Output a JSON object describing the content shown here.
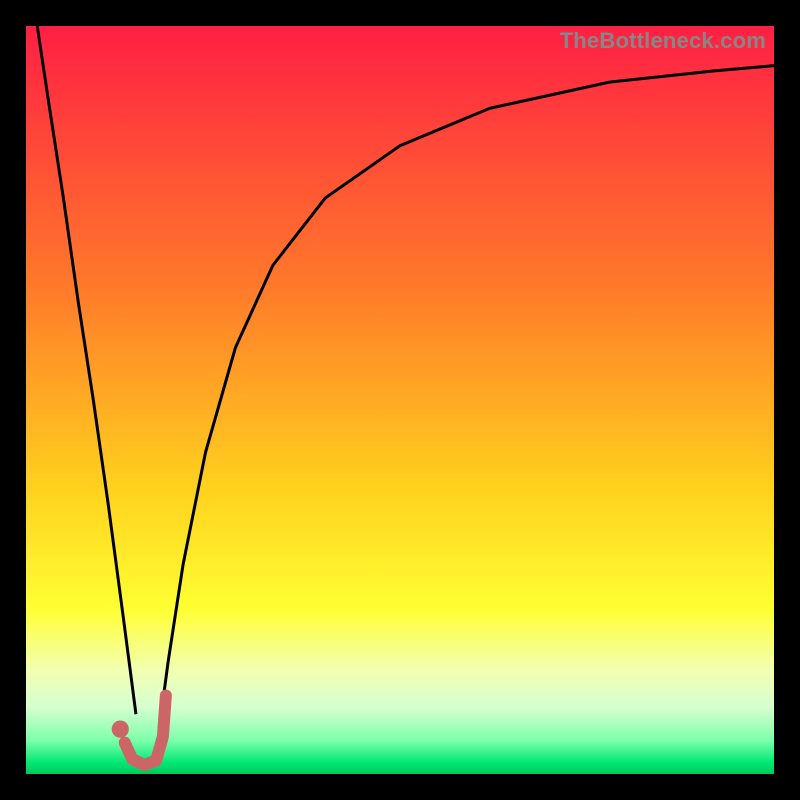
{
  "watermark": "TheBottleneck.com",
  "chart_data": {
    "type": "line",
    "title": "",
    "xlabel": "",
    "ylabel": "",
    "xlim": [
      0,
      100
    ],
    "ylim": [
      0,
      100
    ],
    "gradient_stops": [
      {
        "offset": 0,
        "color": "#ff1f44"
      },
      {
        "offset": 0.35,
        "color": "#ff7a2a"
      },
      {
        "offset": 0.62,
        "color": "#ffd21e"
      },
      {
        "offset": 0.78,
        "color": "#ffff33"
      },
      {
        "offset": 0.86,
        "color": "#f2ffb0"
      },
      {
        "offset": 0.91,
        "color": "#d7ffd0"
      },
      {
        "offset": 0.955,
        "color": "#7dffaa"
      },
      {
        "offset": 0.985,
        "color": "#00e874"
      },
      {
        "offset": 1.0,
        "color": "#00c85a"
      }
    ],
    "series": [
      {
        "name": "left-limb",
        "stroke": "#000000",
        "width": 3,
        "x": [
          1.5,
          3,
          5,
          7,
          9,
          11,
          13,
          14.7
        ],
        "y": [
          100,
          90,
          77,
          63,
          50,
          36,
          21,
          8
        ]
      },
      {
        "name": "right-limb",
        "stroke": "#000000",
        "width": 3,
        "x": [
          17.8,
          19,
          21,
          24,
          28,
          33,
          40,
          50,
          62,
          78,
          92,
          100
        ],
        "y": [
          6,
          15,
          28,
          43,
          57,
          68,
          77,
          84,
          89,
          92.5,
          94,
          94.7
        ]
      },
      {
        "name": "valley-j",
        "stroke": "#cc6666",
        "width": 12,
        "linecap": "round",
        "x": [
          13.2,
          14.2,
          15.8,
          17.4,
          18.3,
          18.7
        ],
        "y": [
          4.2,
          2.0,
          1.2,
          1.8,
          5.0,
          10.5
        ]
      }
    ],
    "marker": {
      "name": "valley-dot",
      "fill": "#cc6666",
      "x": 12.6,
      "y": 6.0,
      "r": 1.15
    }
  }
}
